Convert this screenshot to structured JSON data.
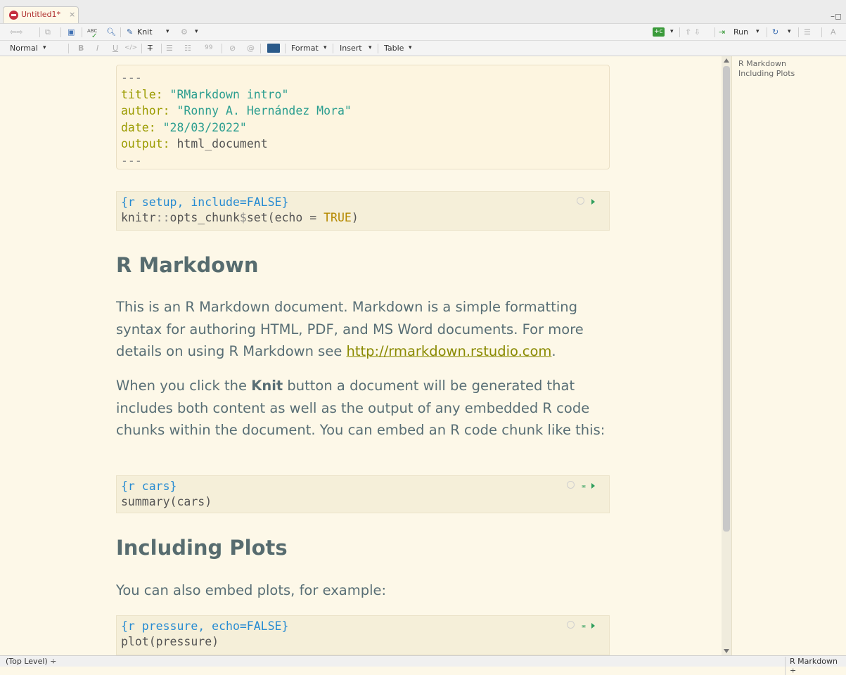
{
  "tab": {
    "title": "Untitled1*",
    "close": "×"
  },
  "window": {
    "controls": "–◻"
  },
  "toolbar": {
    "knit": "Knit",
    "knit_caret": "▾",
    "spell_abc": "ABC",
    "run": "Run",
    "caret": "▾",
    "nav_arrows": "⇦⇨",
    "up_down": "⇧ ⇩",
    "insert_chunk": "+c"
  },
  "format_bar": {
    "style": "Normal",
    "bold": "B",
    "italic": "I",
    "underline": "U",
    "code": "</>",
    "clear": "T̶",
    "bullet": "☰",
    "numbered": "☷",
    "quote": "99",
    "link": "⊘",
    "at": "@",
    "format": "Format",
    "insert": "Insert",
    "table": "Table"
  },
  "yaml": {
    "dashes": "---",
    "title_key": "title:",
    "title_val": "\"RMarkdown intro\"",
    "author_key": "author:",
    "author_val": "\"Ronny A. Hernández Mora\"",
    "date_key": "date:",
    "date_val": "\"28/03/2022\"",
    "output_key": "output:",
    "output_val": "html_document"
  },
  "chunk_setup": {
    "header": "{r setup, include=FALSE}",
    "code_a": "knitr",
    "code_op": "::",
    "code_b": "opts_chunk",
    "code_dollar": "$",
    "code_c": "set(echo = ",
    "code_true": "TRUE",
    "code_d": ")"
  },
  "heading1": "R Markdown",
  "para1": {
    "text_a": "This is an R Markdown document. Markdown is a simple formatting syntax for authoring HTML, PDF, and MS Word documents. For more details on using R Markdown see ",
    "link": "http://rmarkdown.rstudio.com",
    "text_b": "."
  },
  "para2": {
    "text_a": "When you click the ",
    "bold": "Knit",
    "text_b": " button a document will be generated that includes both content as well as the output of any embedded R code chunks within the document. You can embed an R code chunk like this:"
  },
  "chunk_cars": {
    "header": "{r cars}",
    "code": "summary(cars)"
  },
  "heading2": "Including Plots",
  "para3": "You can also embed plots, for example:",
  "chunk_pressure": {
    "header": "{r pressure, echo=FALSE}",
    "code": "plot(pressure)"
  },
  "chunk_icons": {
    "bar": "≖"
  },
  "outline": {
    "items": [
      "R Markdown",
      "Including Plots"
    ]
  },
  "status": {
    "left": "(Top Level) ÷",
    "right": "R Markdown ÷"
  },
  "colors": {
    "background": "#fdf8e8",
    "heading": "#576c6f",
    "body_text": "#586e75",
    "yaml_key": "#9b9b00",
    "yaml_string": "#2a9d8f",
    "chunk_header": "#268bd2",
    "run_green": "#2e9e5c"
  }
}
